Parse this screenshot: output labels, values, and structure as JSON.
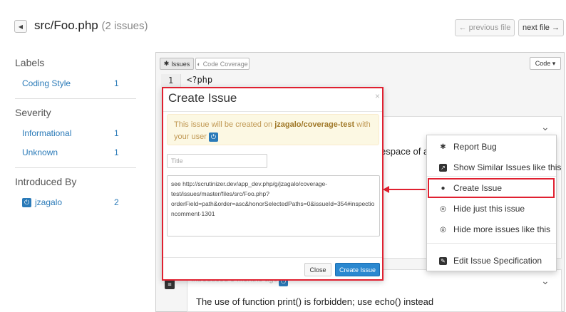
{
  "header": {
    "file_path": "src/Foo.php",
    "issue_count": "(2 issues)",
    "prev_label": "← previous file",
    "next_label": "next file →"
  },
  "sidebar": {
    "labels_heading": "Labels",
    "labels": [
      {
        "name": "Coding Style",
        "count": "1"
      }
    ],
    "severity_heading": "Severity",
    "severity": [
      {
        "name": "Informational",
        "count": "1"
      },
      {
        "name": "Unknown",
        "count": "1"
      }
    ],
    "introduced_heading": "Introduced By",
    "introduced": [
      {
        "name": "jzagalo",
        "count": "2"
      }
    ]
  },
  "toolbar": {
    "issues_tab": "Issues",
    "coverage_tab": "Code Coverage",
    "code_button": "Code ▾"
  },
  "code": {
    "line_number": "1",
    "line_text": "<?php"
  },
  "issues": {
    "first_text": "espace of at",
    "second_meta": "Introduced 3 months ago by",
    "second_text": "The use of function print() is forbidden; use echo() instead"
  },
  "modal": {
    "title": "Create Issue",
    "close_x": "×",
    "alert_prefix": "This issue will be created on ",
    "alert_repo": "jzagalo/coverage-test",
    "alert_suffix": " with your user",
    "title_placeholder": "Title",
    "body": "see http://scrutinizer.dev/app_dev.php/g/jzagalo/coverage-test/issues/master/files/src/Foo.php?orderField=path&order=asc&honorSelectedPaths=0&issueId=354#inspectioncomment-1301",
    "close_button": "Close",
    "create_button": "Create Issue"
  },
  "menu": {
    "report_bug": "Report Bug",
    "show_similar": "Show Similar Issues like this",
    "create_issue": "Create Issue",
    "hide_this": "Hide just this issue",
    "hide_more": "Hide more issues like this",
    "edit_spec": "Edit Issue Specification"
  },
  "colors": {
    "link": "#2a7ab8",
    "highlight": "#e02030",
    "primary": "#2a88d0"
  }
}
